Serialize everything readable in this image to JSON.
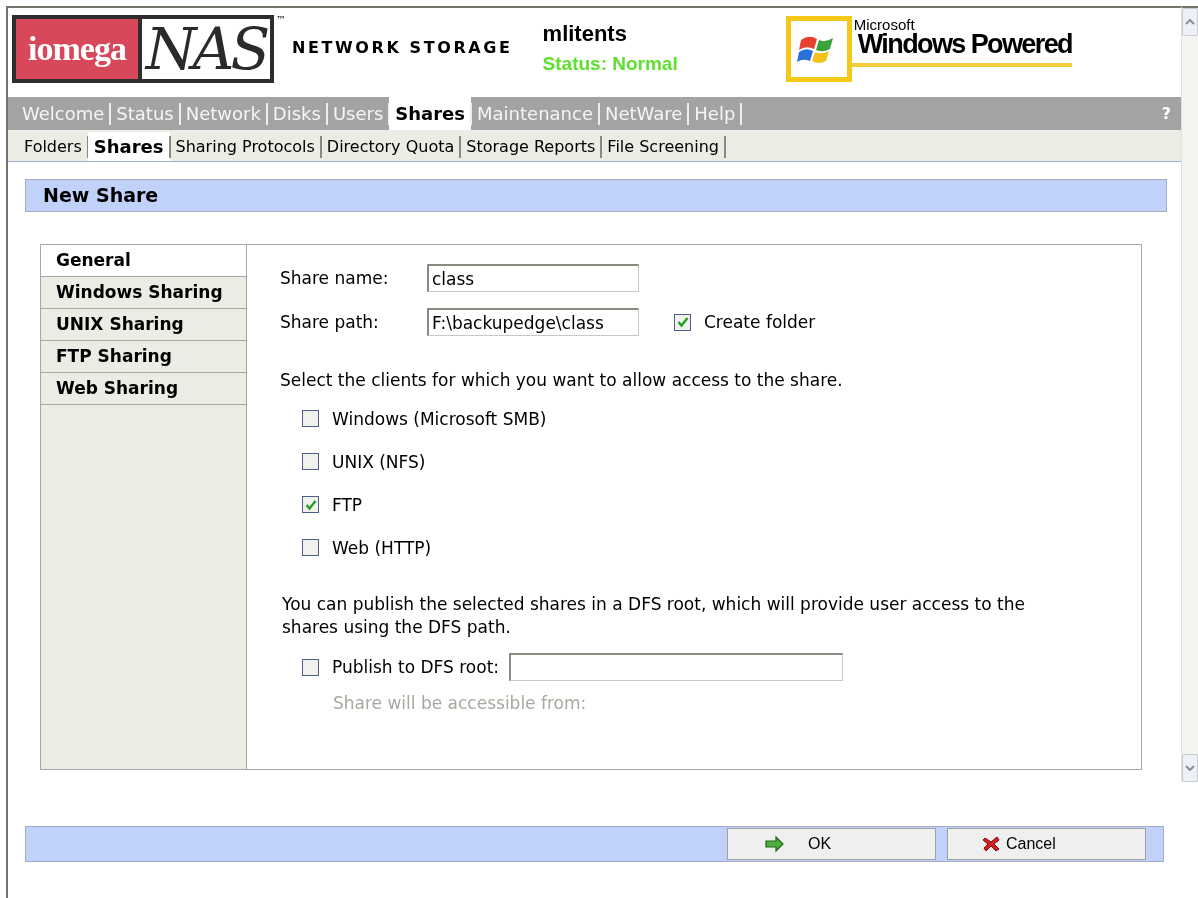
{
  "header": {
    "logo": {
      "brand": "iomega",
      "product": "NAS",
      "trademark": "™",
      "tagline": "NETWORK STORAGE"
    },
    "server_name": "mlitents",
    "status": "Status: Normal",
    "partner_logo": {
      "maker": "Microsoft",
      "product": "Windows Powered"
    }
  },
  "nav": {
    "tabs": [
      {
        "label": "Welcome",
        "selected": false
      },
      {
        "label": "Status",
        "selected": false
      },
      {
        "label": "Network",
        "selected": false
      },
      {
        "label": "Disks",
        "selected": false
      },
      {
        "label": "Users",
        "selected": false
      },
      {
        "label": "Shares",
        "selected": true
      },
      {
        "label": "Maintenance",
        "selected": false
      },
      {
        "label": "NetWare",
        "selected": false
      },
      {
        "label": "Help",
        "selected": false
      }
    ],
    "help": "?"
  },
  "subnav": {
    "tabs": [
      {
        "label": "Folders",
        "selected": false
      },
      {
        "label": "Shares",
        "selected": true
      },
      {
        "label": "Sharing Protocols",
        "selected": false
      },
      {
        "label": "Directory Quota",
        "selected": false
      },
      {
        "label": "Storage Reports",
        "selected": false
      },
      {
        "label": "File Screening",
        "selected": false
      }
    ]
  },
  "page_title": "New Share",
  "side_tabs": [
    {
      "label": "General",
      "selected": true
    },
    {
      "label": "Windows Sharing",
      "selected": false
    },
    {
      "label": "UNIX Sharing",
      "selected": false
    },
    {
      "label": "FTP Sharing",
      "selected": false
    },
    {
      "label": "Web Sharing",
      "selected": false
    }
  ],
  "form": {
    "share_name": {
      "label": "Share name:",
      "value": "class"
    },
    "share_path": {
      "label": "Share path:",
      "value": "F:\\backupedge\\class"
    },
    "create_folder": {
      "label": "Create folder",
      "checked": true
    },
    "clients_prompt": "Select the clients for which you want to allow access to the share.",
    "clients": [
      {
        "label": "Windows (Microsoft SMB)",
        "checked": false
      },
      {
        "label": "UNIX (NFS)",
        "checked": false
      },
      {
        "label": "FTP",
        "checked": true
      },
      {
        "label": "Web (HTTP)",
        "checked": false
      }
    ],
    "dfs_note": "You can publish the selected shares in a DFS root, which will provide user access to the shares using the DFS path.",
    "publish_dfs": {
      "label": "Publish to DFS root:",
      "checked": false
    },
    "accessible_hint": {
      "text": "Share will be accessible from:",
      "disabled": true
    }
  },
  "buttons": [
    {
      "label": "OK",
      "kind": "ok"
    },
    {
      "label": "Cancel",
      "kind": "cancel"
    }
  ]
}
